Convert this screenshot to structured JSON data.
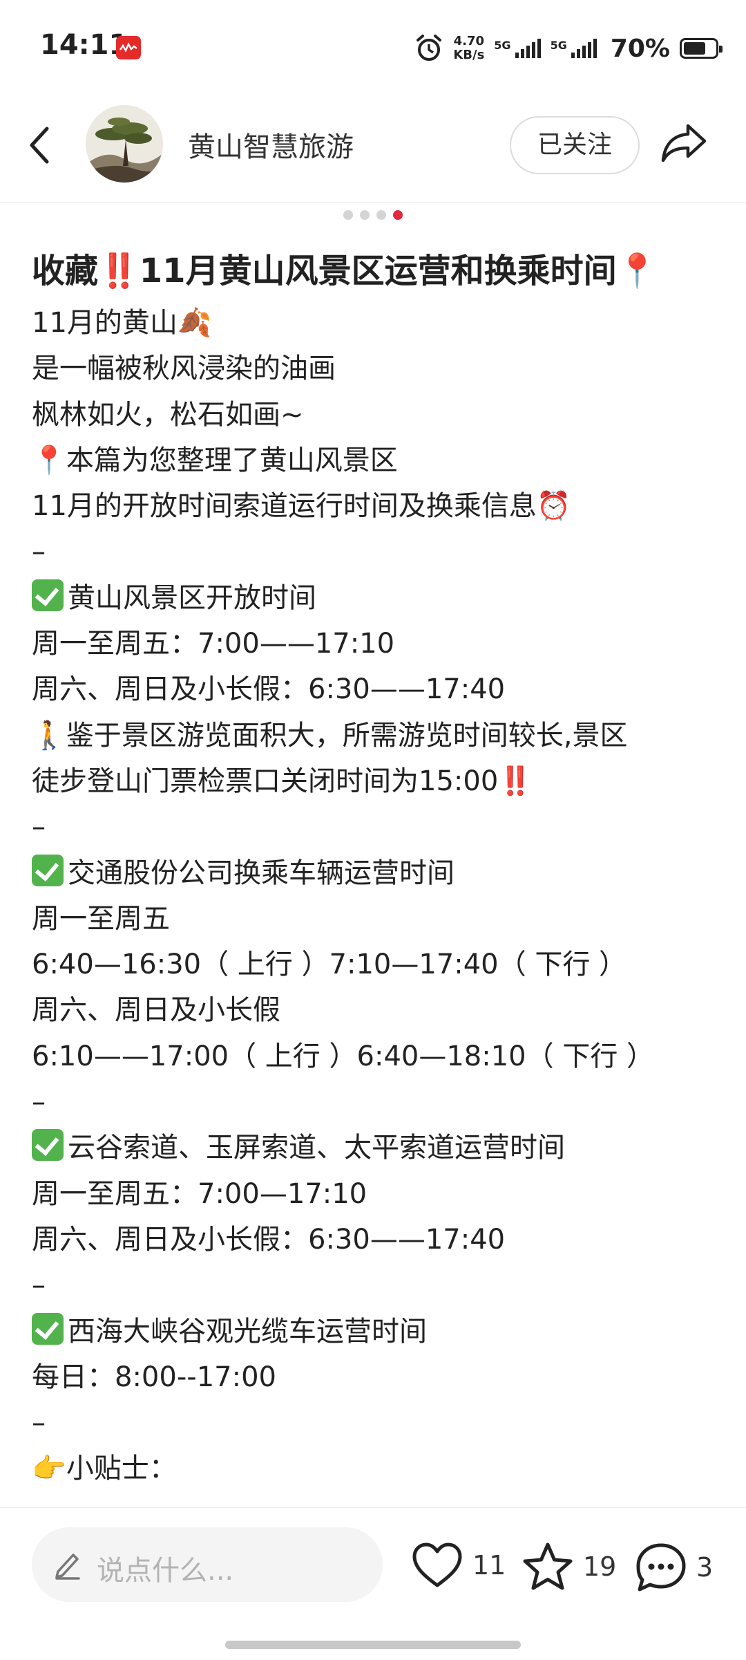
{
  "status_bar": {
    "time": "14:11",
    "net_speed_value": "4.70",
    "net_speed_unit": "KB/s",
    "sim1_label": "5G",
    "sim2_label": "5G",
    "battery_text": "70%",
    "battery_level": 0.7
  },
  "header": {
    "author_name": "黄山智慧旅游",
    "follow_label": "已关注"
  },
  "carousel": {
    "total": 4,
    "active_index": 3
  },
  "post": {
    "title_a": "收藏",
    "title_b": "‼️",
    "title_c": "11月黄山风景区运营和换乘时间",
    "title_d": "📍",
    "intro": {
      "l1": "11月的黄山",
      "l1_emoji": "🍂",
      "l2": "是一幅被秋风浸染的油画",
      "l3": "枫林如火，松石如画~",
      "l4_emoji": "📍",
      "l4": "本篇为您整理了黄山风景区",
      "l5": "11月的开放时间索道运行时间及换乘信息",
      "l5_emoji": "⏰"
    },
    "separator": "–",
    "s1": {
      "heading": "黄山风景区开放时间",
      "weekday": "周一至周五：7:00——17:10",
      "weekend": "周六、周日及小长假：6:30——17:40",
      "note_emoji": "🚶",
      "note_1": "鉴于景区游览面积大，所需游览时间较长,景区",
      "note_2": "徒步登山门票检票口关闭时间为15:00",
      "note_2_emoji": "‼️"
    },
    "s2": {
      "heading": "交通股份公司换乘车辆运营时间",
      "weekday_label": "周一至周五",
      "weekday_times": "6:40—16:30（ 上行 ）7:10—17:40（ 下行 ）",
      "weekend_label": "周六、周日及小长假",
      "weekend_times": "6:10——17:00（ 上行 ）6:40—18:10（ 下行 ）"
    },
    "s3": {
      "heading": "云谷索道、玉屏索道、太平索道运营时间",
      "weekday": "周一至周五：7:00—17:10",
      "weekend": "周六、周日及小长假：6:30——17:40"
    },
    "s4": {
      "heading": "西海大峡谷观光缆车运营时间",
      "daily": "每日：8:00--17:00"
    },
    "tips_emoji": "👉",
    "tips_label": "小贴士："
  },
  "bottom_bar": {
    "comment_placeholder": "说点什么...",
    "likes": "11",
    "favorites": "19",
    "comments": "3"
  },
  "icons": {
    "back": "chevron-left-icon",
    "share": "share-arrow-icon",
    "like": "heart-outline-icon",
    "favorite": "star-outline-icon",
    "comment": "speech-bubble-icon",
    "edit": "pen-icon",
    "check": "green-check-box-emoji"
  },
  "colors": {
    "accent": "#e0283f",
    "check_green": "#52b34d",
    "text": "#222222",
    "placeholder": "#b3b3b3"
  }
}
